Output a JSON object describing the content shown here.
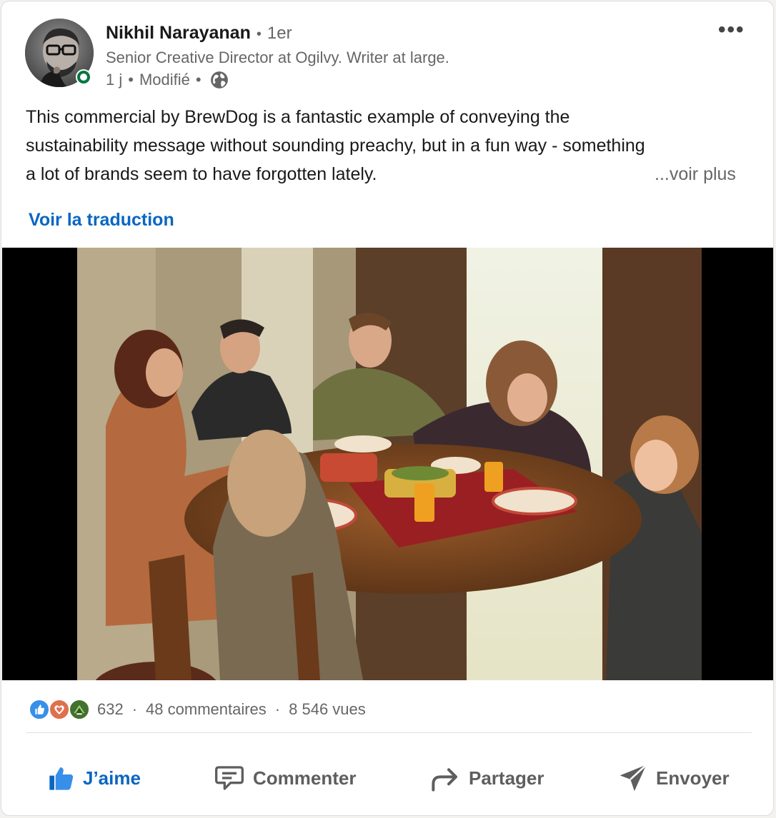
{
  "post": {
    "author": {
      "name": "Nikhil Narayanan",
      "degree": "1er",
      "headline": "Senior Creative Director at Ogilvy. Writer at large.",
      "time": "1 j",
      "edited": "Modifié"
    },
    "menu_glyph": "•••",
    "text_lines": [
      "This commercial by BrewDog is a fantastic example of conveying the",
      "sustainability message without sounding preachy, but in a fun way - something",
      "a lot of brands seem to have forgotten lately."
    ],
    "see_more": "...voir plus",
    "translate_label": "Voir la traduction"
  },
  "social": {
    "reactions_count": "632",
    "comments": "48 commentaires",
    "views": "8 546 vues",
    "reaction_icons": [
      "like-icon",
      "love-icon",
      "insightful-icon"
    ]
  },
  "actions": {
    "like": "J’aime",
    "comment": "Commenter",
    "share": "Partager",
    "send": "Envoyer"
  },
  "colors": {
    "brand_blue": "#0a66c2",
    "presence_green": "#057642",
    "muted_text": "#666666"
  }
}
